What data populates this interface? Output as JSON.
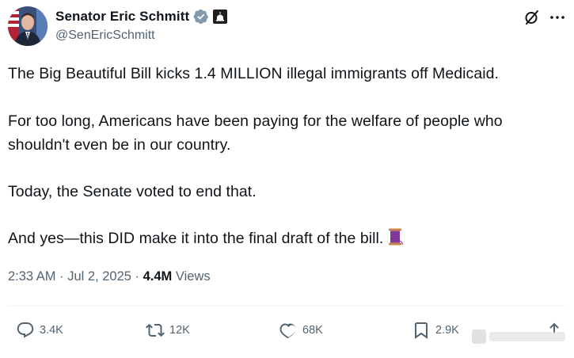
{
  "author": {
    "display_name": "Senator Eric Schmitt",
    "handle": "@SenEricSchmitt",
    "verified_color": "#829aab"
  },
  "post": {
    "paragraphs": [
      "The Big Beautiful Bill kicks 1.4 MILLION illegal immigrants off Medicaid.",
      "For too long, Americans have been paying for the welfare of people who shouldn't even be in our country.",
      "Today, the Senate voted to end that.",
      "And yes—this DID make it into the final draft of the bill."
    ],
    "emoji_icon": "thread-spool-icon"
  },
  "meta": {
    "time": "2:33 AM",
    "separator": " · ",
    "date": "Jul 2, 2025",
    "views_count": "4.4M",
    "views_label": "Views"
  },
  "actions": {
    "replies": "3.4K",
    "reposts": "12K",
    "likes": "68K",
    "bookmarks": "2.9K"
  },
  "colors": {
    "text": "#0f1419",
    "secondary": "#536471",
    "divider": "#eff3f4"
  }
}
